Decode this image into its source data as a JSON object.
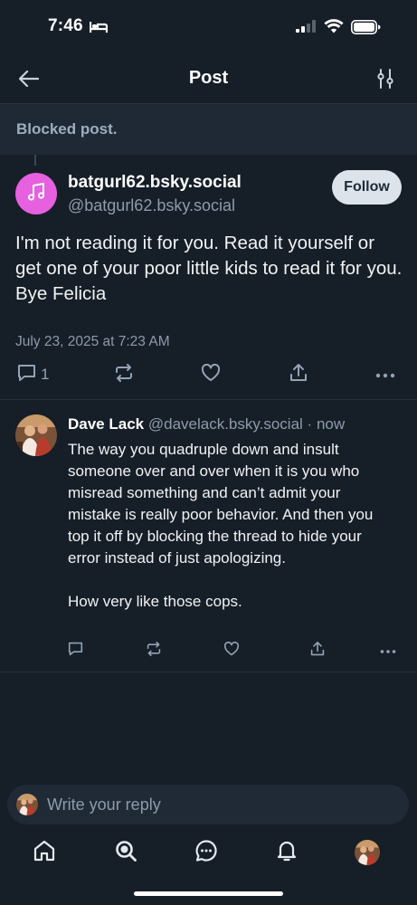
{
  "status_bar": {
    "time": "7:46"
  },
  "header": {
    "title": "Post",
    "back_icon": "arrow-left-icon",
    "options_icon": "sliders-icon"
  },
  "blocked": {
    "text": "Blocked post."
  },
  "main_post": {
    "display_name": "batgurl62.bsky.social",
    "handle": "@batgurl62.bsky.social",
    "follow_label": "Follow",
    "text": "I'm not reading it for you. Read it yourself or get one of your poor little kids to read it for you. Bye Felicia",
    "timestamp": "July 23, 2025 at 7:23 AM",
    "reply_count": "1",
    "avatar_icon": "music-note-icon",
    "avatar_color": "#e660e0"
  },
  "reply_post": {
    "display_name": "Dave Lack",
    "handle": "@davelack.bsky.social",
    "separator": " · ",
    "time": "now",
    "text": "The way you quadruple down and insult someone over and over when it is you who misread something and can’t admit your mistake is really poor behavior. And then you top it off by blocking the thread to hide your error instead of just apologizing.\n\nHow very like those cops."
  },
  "composer": {
    "placeholder": "Write your reply"
  },
  "nav": {
    "items": [
      "home-icon",
      "search-icon",
      "chat-icon",
      "bell-icon",
      "profile-avatar"
    ]
  },
  "colors": {
    "background": "#161e27",
    "blocked_bar": "#1e2935",
    "muted_text": "#8d9bab",
    "icon": "#93a3b6"
  }
}
